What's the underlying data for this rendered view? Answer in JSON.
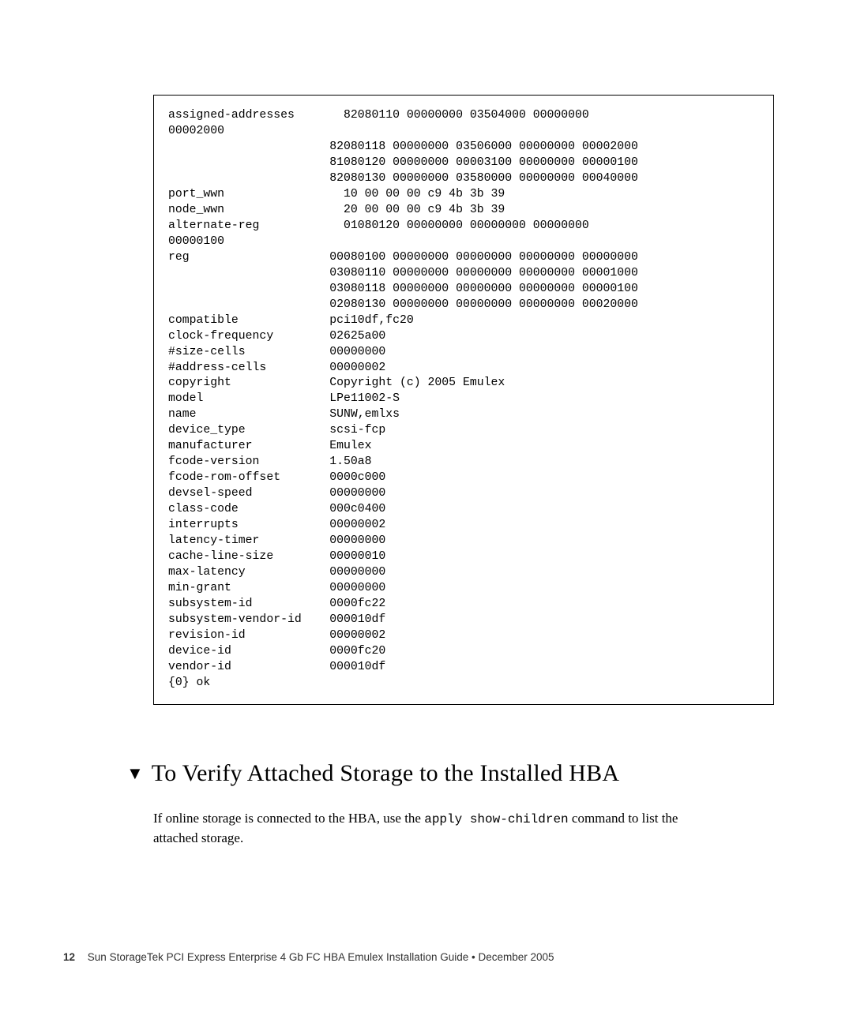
{
  "code_block": "assigned-addresses       82080110 00000000 03504000 00000000\n00002000\n                       82080118 00000000 03506000 00000000 00002000\n                       81080120 00000000 00003100 00000000 00000100\n                       82080130 00000000 03580000 00000000 00040000\nport_wwn                 10 00 00 00 c9 4b 3b 39\nnode_wwn                 20 00 00 00 c9 4b 3b 39\nalternate-reg            01080120 00000000 00000000 00000000\n00000100\nreg                    00080100 00000000 00000000 00000000 00000000\n                       03080110 00000000 00000000 00000000 00001000\n                       03080118 00000000 00000000 00000000 00000100\n                       02080130 00000000 00000000 00000000 00020000\ncompatible             pci10df,fc20\nclock-frequency        02625a00\n#size-cells            00000000\n#address-cells         00000002\ncopyright              Copyright (c) 2005 Emulex\nmodel                  LPe11002-S\nname                   SUNW,emlxs\ndevice_type            scsi-fcp\nmanufacturer           Emulex\nfcode-version          1.50a8\nfcode-rom-offset       0000c000\ndevsel-speed           00000000\nclass-code             000c0400\ninterrupts             00000002\nlatency-timer          00000000\ncache-line-size        00000010\nmax-latency            00000000\nmin-grant              00000000\nsubsystem-id           0000fc22\nsubsystem-vendor-id    000010df\nrevision-id            00000002\ndevice-id              0000fc20\nvendor-id              000010df\n{0} ok",
  "section": {
    "triangle": "▼",
    "title": "To Verify Attached Storage to the Installed HBA",
    "body_pre": "If online storage is connected to the HBA, use the ",
    "body_cmd": "apply show-children",
    "body_post": " command to list the attached storage."
  },
  "footer": {
    "page_num": "12",
    "text": "Sun StorageTek PCI Express Enterprise 4 Gb FC HBA Emulex Installation Guide  •  December 2005"
  }
}
